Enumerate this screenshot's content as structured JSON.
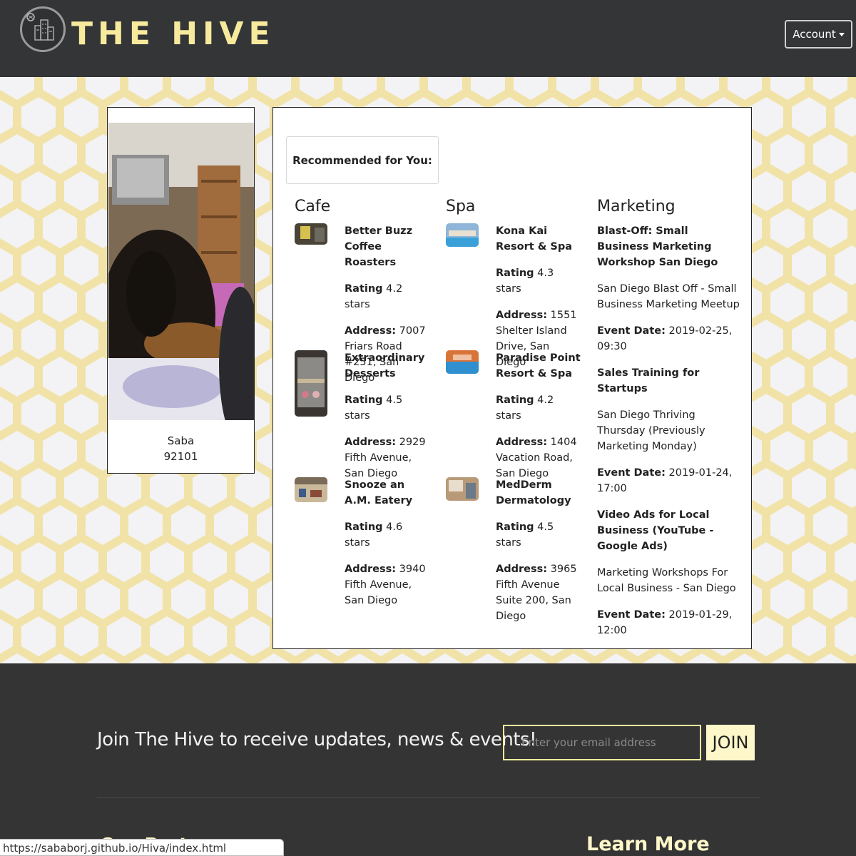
{
  "header": {
    "brand": "THE HIVE",
    "account_label": "Account"
  },
  "profile": {
    "name": "Saba",
    "zip": "92101"
  },
  "recommendations": {
    "heading": "Recommended for You:",
    "cafe": {
      "title": "Cafe",
      "items": [
        {
          "name": "Better Buzz Coffee Roasters",
          "rating": "4.2 stars",
          "address": "7007 Friars Road #251, San Diego"
        },
        {
          "name": "Extraordinary Desserts",
          "rating": "4.5 stars",
          "address": "2929 Fifth Avenue, San Diego"
        },
        {
          "name": "Snooze an A.M. Eatery",
          "rating": "4.6 stars",
          "address": "3940 Fifth Avenue, San Diego"
        }
      ]
    },
    "spa": {
      "title": "Spa",
      "items": [
        {
          "name": "Kona Kai Resort & Spa",
          "rating": "4.3 stars",
          "address": "1551 Shelter Island Drive, San Diego"
        },
        {
          "name": "Paradise Point Resort & Spa",
          "rating": "4.2 stars",
          "address": "1404 Vacation Road, San Diego"
        },
        {
          "name": "MedDerm Dermatology",
          "rating": "4.5 stars",
          "address": "3965 Fifth Avenue Suite 200, San Diego"
        }
      ]
    },
    "marketing": {
      "title": "Marketing",
      "events": [
        {
          "name": "Blast-Off: Small Business Marketing Workshop San Diego",
          "group": "San Diego Blast Off - Small Business Marketing Meetup",
          "date": "2019-02-25, 09:30"
        },
        {
          "name": "Sales Training for Startups",
          "group": "San Diego Thriving Thursday (Previously Marketing Monday)",
          "date": "2019-01-24, 17:00"
        },
        {
          "name": "Video Ads for Local Business (YouTube - Google Ads)",
          "group": "Marketing Workshops For Local Business - San Diego",
          "date": "2019-01-29, 12:00"
        }
      ]
    },
    "labels": {
      "rating": "Rating",
      "address": "Address:",
      "event_date": "Event Date:"
    }
  },
  "footer": {
    "join_text": "Join The Hive to receive updates, news & events!",
    "email_placeholder": "Enter your email address",
    "join_button": "JOIN",
    "learn_more": "Learn More",
    "partners": "Our Partners"
  },
  "status_bar": {
    "url": "https://sababorj.github.io/Hiva/index.html"
  },
  "colors": {
    "header_bg": "#333537",
    "brand": "#f7ea9c",
    "honeycomb": "#f1e2a8",
    "footer_bg": "#343434",
    "accent": "#fdf7c9"
  }
}
